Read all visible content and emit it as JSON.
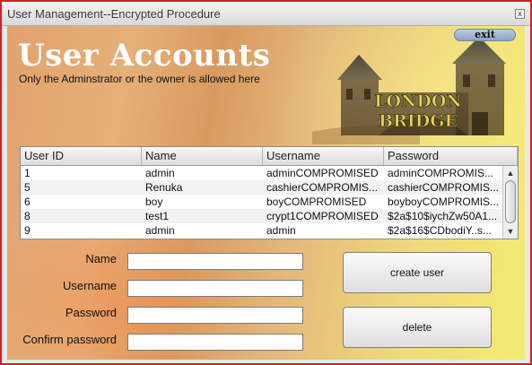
{
  "window": {
    "title": "User Management--Encrypted Procedure",
    "close_glyph": "x"
  },
  "header": {
    "title": "User Accounts",
    "subtitle": "Only the Adminstrator or the owner is allowed here",
    "exit_label": "exit",
    "image": {
      "description_icon": "london-bridge-image",
      "text_line1": "LONDON",
      "text_line2": "BRIDGE"
    }
  },
  "table": {
    "columns": [
      "User ID",
      "Name",
      "Username",
      "Password"
    ],
    "rows": [
      [
        "1",
        "admin",
        "adminCOMPROMISED",
        "adminCOMPROMIS..."
      ],
      [
        "5",
        "Renuka",
        "cashierCOMPROMIS...",
        "cashierCOMPROMIS..."
      ],
      [
        "6",
        "boy",
        "boyCOMPROMISED",
        "boyboyCOMPROMIS..."
      ],
      [
        "8",
        "test1",
        "crypt1COMPROMISED",
        "$2a$10$iychZw50A1..."
      ],
      [
        "9",
        "admin",
        "admin",
        "$2a$16$CDbodiY..s..."
      ]
    ],
    "scroll_up_glyph": "▲",
    "scroll_down_glyph": "▼"
  },
  "form": {
    "name_label": "Name",
    "username_label": "Username",
    "password_label": "Password",
    "confirm_label": "Confirm password",
    "name_value": "",
    "username_value": "",
    "password_value": "",
    "confirm_value": ""
  },
  "buttons": {
    "create_label": "create user",
    "delete_label": "delete"
  },
  "colors": {
    "window_border": "#d42020",
    "title_text": "#ffffff",
    "exit_button": "#9bb3d3"
  }
}
